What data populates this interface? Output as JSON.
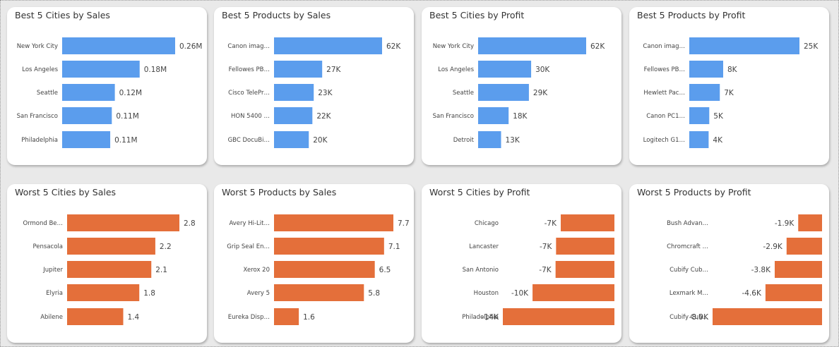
{
  "colors": {
    "positive": "#5b9ded",
    "negative": "#e46f3a"
  },
  "chart_data": [
    {
      "title": "Best 5 Cities by Sales",
      "type": "bar",
      "orientation": "horizontal",
      "color": "#5b9ded",
      "categories": [
        "New York City",
        "Los Angeles",
        "Seattle",
        "San Francisco",
        "Philadelphia"
      ],
      "values": [
        256368,
        175851,
        119541,
        112669,
        109077
      ],
      "data_labels": [
        "0.26M",
        "0.18M",
        "0.12M",
        "0.11M",
        "0.11M"
      ]
    },
    {
      "title": "Best 5 Products by Sales",
      "type": "bar",
      "orientation": "horizontal",
      "color": "#5b9ded",
      "categories": [
        "Canon imag…",
        "Fellowes PB…",
        "Cisco TelePr…",
        "HON 5400 …",
        "GBC DocuBi…"
      ],
      "values": [
        61600,
        27453,
        22638,
        21871,
        19823
      ],
      "data_labels": [
        "62K",
        "27K",
        "23K",
        "22K",
        "20K"
      ]
    },
    {
      "title": "Best 5 Cities by Profit",
      "type": "bar",
      "orientation": "horizontal",
      "color": "#5b9ded",
      "categories": [
        "New York City",
        "Los Angeles",
        "Seattle",
        "San Francisco",
        "Detroit"
      ],
      "values": [
        62037,
        30441,
        29156,
        17507,
        13181
      ],
      "data_labels": [
        "62K",
        "30K",
        "29K",
        "18K",
        "13K"
      ]
    },
    {
      "title": "Best 5 Products by Profit",
      "type": "bar",
      "orientation": "horizontal",
      "color": "#5b9ded",
      "categories": [
        "Canon imag…",
        "Fellowes PB…",
        "Hewlett Pac…",
        "Canon PC1…",
        "Logitech G1…"
      ],
      "values": [
        25200,
        7753,
        6984,
        4571,
        4425
      ],
      "data_labels": [
        "25K",
        "8K",
        "7K",
        "5K",
        "4K"
      ]
    },
    {
      "title": "Worst 5 Cities by Sales",
      "type": "bar",
      "orientation": "horizontal",
      "color": "#e46f3a",
      "categories": [
        "Ormond Be…",
        "Pensacola",
        "Jupiter",
        "Elyria",
        "Abilene"
      ],
      "values": [
        2.8,
        2.2,
        2.1,
        1.8,
        1.4
      ],
      "data_labels": [
        "2.8",
        "2.2",
        "2.1",
        "1.8",
        "1.4"
      ]
    },
    {
      "title": "Worst 5 Products by Sales",
      "type": "bar",
      "orientation": "horizontal",
      "color": "#e46f3a",
      "categories": [
        "Avery Hi-Lit…",
        "Grip Seal En…",
        "Xerox 20",
        "Avery 5",
        "Eureka Disp…"
      ],
      "values": [
        7.7,
        7.1,
        6.5,
        5.8,
        1.6
      ],
      "data_labels": [
        "7.7",
        "7.1",
        "6.5",
        "5.8",
        "1.6"
      ]
    },
    {
      "title": "Worst 5 Cities by Profit",
      "type": "bar",
      "orientation": "horizontal",
      "color": "#e46f3a",
      "categories": [
        "Chicago",
        "Lancaster",
        "San Antonio",
        "Houston",
        "Philadelphia"
      ],
      "values": [
        -6655,
        -7239,
        -7299,
        -10154,
        -13838
      ],
      "data_labels": [
        "-7K",
        "-7K",
        "-7K",
        "-10K",
        "-14K"
      ]
    },
    {
      "title": "Worst 5 Products by Profit",
      "type": "bar",
      "orientation": "horizontal",
      "color": "#e46f3a",
      "categories": [
        "Bush Advan…",
        "Chromcraft …",
        "Cubify Cub…",
        "Lexmark M…",
        "Cubify Cub…"
      ],
      "values": [
        -1934,
        -2877,
        -3840,
        -4590,
        -8880
      ],
      "data_labels": [
        "-1.9K",
        "-2.9K",
        "-3.8K",
        "-4.6K",
        "-8.9K"
      ]
    }
  ]
}
